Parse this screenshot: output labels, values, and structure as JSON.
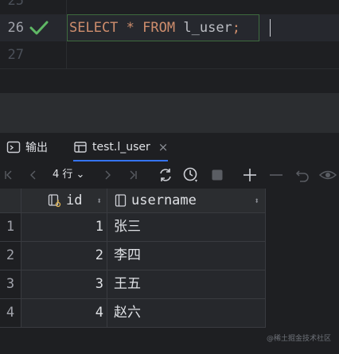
{
  "editor": {
    "lines": [
      {
        "number": "25",
        "code": ""
      },
      {
        "number": "26",
        "code": "SELECT * FROM l_user;",
        "status_icon": "check-icon"
      },
      {
        "number": "27",
        "code": ""
      }
    ],
    "code_tokens": {
      "select": "SELECT",
      "star": "*",
      "from": "FROM",
      "table": "l_user",
      "semicolon": ";"
    }
  },
  "tool_window": {
    "tabs": [
      {
        "label": "输出",
        "icon": "console-icon"
      },
      {
        "label": "test.l_user",
        "icon": "table-icon",
        "active": true
      }
    ],
    "close_glyph": "×"
  },
  "toolbar": {
    "rows_label": "4 行",
    "icons": [
      "first-page-icon",
      "prev-page-icon",
      "next-page-icon",
      "last-page-icon",
      "refresh-icon",
      "history-icon",
      "stop-icon",
      "add-row-icon",
      "delete-row-icon",
      "revert-icon",
      "preview-icon"
    ]
  },
  "grid": {
    "columns": [
      {
        "name": "id",
        "icon": "key-column-icon"
      },
      {
        "name": "username",
        "icon": "column-icon"
      }
    ],
    "rows": [
      {
        "num": "1",
        "id": "1",
        "username": "张三"
      },
      {
        "num": "2",
        "id": "2",
        "username": "李四"
      },
      {
        "num": "3",
        "id": "3",
        "username": "王五"
      },
      {
        "num": "4",
        "id": "4",
        "username": "赵六"
      }
    ]
  },
  "watermark": "@稀土掘金技术社区",
  "colors": {
    "keyword": "#cf8e6d",
    "accent": "#3574f0",
    "check": "#5fb865",
    "background": "#1e1f22"
  }
}
